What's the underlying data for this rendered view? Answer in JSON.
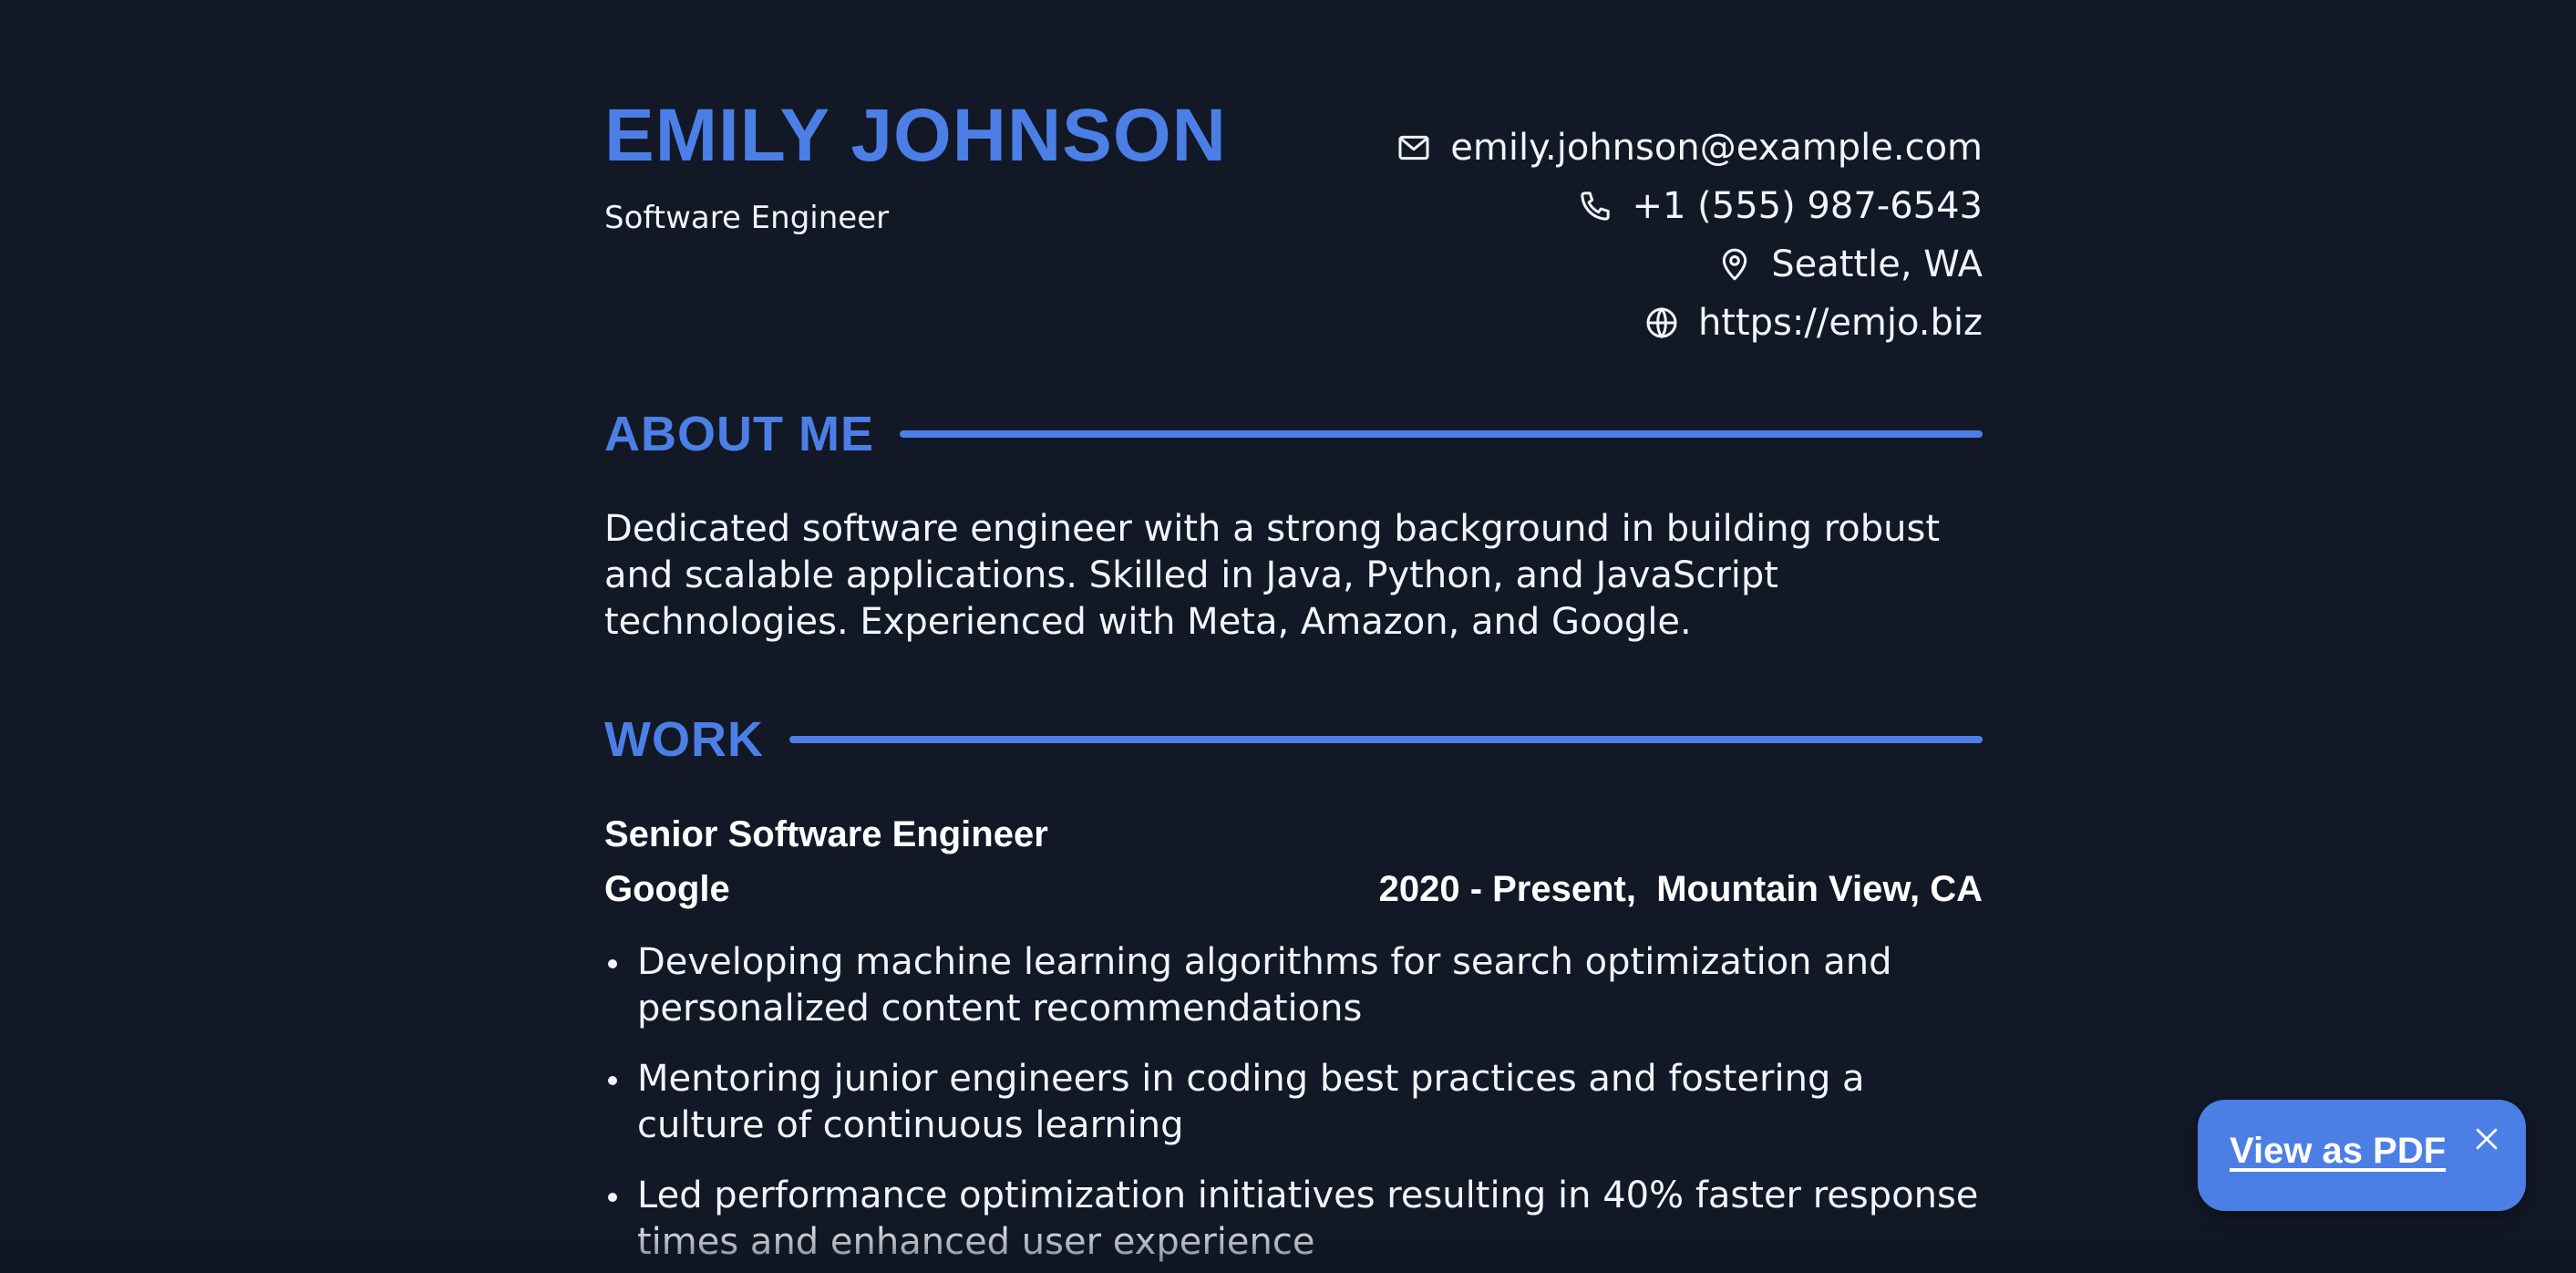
{
  "header": {
    "name": "EMILY JOHNSON",
    "role": "Software Engineer"
  },
  "contacts": [
    {
      "icon": "mail-icon",
      "text": "emily.johnson@example.com"
    },
    {
      "icon": "phone-icon",
      "text": "+1 (555) 987-6543"
    },
    {
      "icon": "location-pin-icon",
      "text": "Seattle, WA"
    },
    {
      "icon": "globe-icon",
      "text": "https://emjo.biz"
    }
  ],
  "about": {
    "title": "ABOUT ME",
    "text": "Dedicated software engineer with a strong background in building robust and scalable applications. Skilled in Java, Python, and JavaScript technologies. Experienced with Meta, Amazon, and Google."
  },
  "work": {
    "title": "WORK",
    "jobs": [
      {
        "title": "Senior Software Engineer",
        "company": "Google",
        "meta": "2020 - Present,  Mountain View, CA",
        "bullets": [
          "Developing machine learning algorithms for search optimization and personalized content recommendations",
          "Mentoring junior engineers in coding best practices and fostering a culture of continuous learning",
          "Led performance optimization initiatives resulting in 40% faster response times and enhanced user experience"
        ]
      }
    ]
  },
  "pdf_button": {
    "label": "View as PDF",
    "close_icon": "close-icon"
  },
  "colors": {
    "background": "#121826",
    "accent": "#4c7fe6",
    "text": "#f1f4f9"
  }
}
